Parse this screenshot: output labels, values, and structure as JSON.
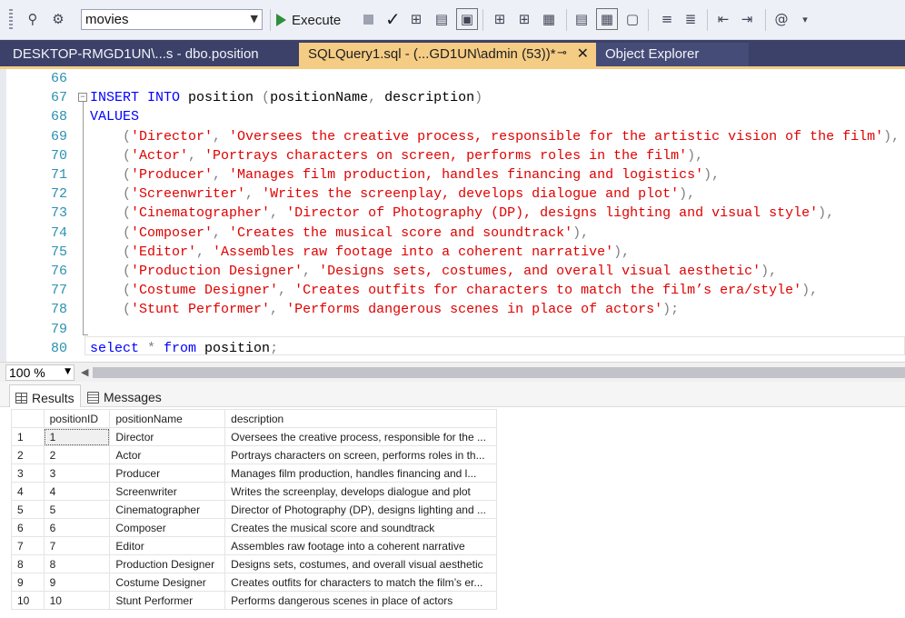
{
  "toolbar": {
    "database": "movies",
    "execute_label": "Execute",
    "icons": [
      "plugin-icon",
      "connect-icon",
      "database-dropdown",
      "execute-icon",
      "stop-icon",
      "parse-check-icon",
      "estimated-plan-icon",
      "query-options-icon",
      "intellisense-icon",
      "results-to-text-icon",
      "results-to-grid-icon",
      "results-to-file-icon",
      "comment-icon",
      "uncomment-icon",
      "decrease-indent-icon",
      "increase-indent-icon",
      "specify-values-icon"
    ]
  },
  "tabs": [
    {
      "label": "DESKTOP-RMGD1UN\\...s - dbo.position",
      "active": false
    },
    {
      "label": "SQLQuery1.sql - (...GD1UN\\admin (53))*",
      "active": true
    },
    {
      "label": "Object Explorer",
      "active": false
    }
  ],
  "editor": {
    "lines": [
      {
        "num": "66",
        "tokens": []
      },
      {
        "num": "67",
        "tokens": [
          [
            "kw",
            "INSERT INTO "
          ],
          [
            "plain",
            "position "
          ],
          [
            "gray",
            "("
          ],
          [
            "plain",
            "positionName"
          ],
          [
            "gray",
            ", "
          ],
          [
            "plain",
            "description"
          ],
          [
            "gray",
            ")"
          ]
        ]
      },
      {
        "num": "68",
        "tokens": [
          [
            "kw",
            "VALUES"
          ]
        ]
      },
      {
        "num": "69",
        "tokens": [
          [
            "gray",
            "    ("
          ],
          [
            "str",
            "'Director'"
          ],
          [
            "gray",
            ", "
          ],
          [
            "str",
            "'Oversees the creative process, responsible for the artistic vision of the film'"
          ],
          [
            "gray",
            "),"
          ]
        ]
      },
      {
        "num": "70",
        "tokens": [
          [
            "gray",
            "    ("
          ],
          [
            "str",
            "'Actor'"
          ],
          [
            "gray",
            ", "
          ],
          [
            "str",
            "'Portrays characters on screen, performs roles in the film'"
          ],
          [
            "gray",
            "),"
          ]
        ]
      },
      {
        "num": "71",
        "tokens": [
          [
            "gray",
            "    ("
          ],
          [
            "str",
            "'Producer'"
          ],
          [
            "gray",
            ", "
          ],
          [
            "str",
            "'Manages film production, handles financing and logistics'"
          ],
          [
            "gray",
            "),"
          ]
        ]
      },
      {
        "num": "72",
        "tokens": [
          [
            "gray",
            "    ("
          ],
          [
            "str",
            "'Screenwriter'"
          ],
          [
            "gray",
            ", "
          ],
          [
            "str",
            "'Writes the screenplay, develops dialogue and plot'"
          ],
          [
            "gray",
            "),"
          ]
        ]
      },
      {
        "num": "73",
        "tokens": [
          [
            "gray",
            "    ("
          ],
          [
            "str",
            "'Cinematographer'"
          ],
          [
            "gray",
            ", "
          ],
          [
            "str",
            "'Director of Photography (DP), designs lighting and visual style'"
          ],
          [
            "gray",
            "),"
          ]
        ]
      },
      {
        "num": "74",
        "tokens": [
          [
            "gray",
            "    ("
          ],
          [
            "str",
            "'Composer'"
          ],
          [
            "gray",
            ", "
          ],
          [
            "str",
            "'Creates the musical score and soundtrack'"
          ],
          [
            "gray",
            "),"
          ]
        ]
      },
      {
        "num": "75",
        "tokens": [
          [
            "gray",
            "    ("
          ],
          [
            "str",
            "'Editor'"
          ],
          [
            "gray",
            ", "
          ],
          [
            "str",
            "'Assembles raw footage into a coherent narrative'"
          ],
          [
            "gray",
            "),"
          ]
        ]
      },
      {
        "num": "76",
        "tokens": [
          [
            "gray",
            "    ("
          ],
          [
            "str",
            "'Production Designer'"
          ],
          [
            "gray",
            ", "
          ],
          [
            "str",
            "'Designs sets, costumes, and overall visual aesthetic'"
          ],
          [
            "gray",
            "),"
          ]
        ]
      },
      {
        "num": "77",
        "tokens": [
          [
            "gray",
            "    ("
          ],
          [
            "str",
            "'Costume Designer'"
          ],
          [
            "gray",
            ", "
          ],
          [
            "str",
            "'Creates outfits for characters to match the film’s era/style'"
          ],
          [
            "gray",
            "),"
          ]
        ]
      },
      {
        "num": "78",
        "tokens": [
          [
            "gray",
            "    ("
          ],
          [
            "str",
            "'Stunt Performer'"
          ],
          [
            "gray",
            ", "
          ],
          [
            "str",
            "'Performs dangerous scenes in place of actors'"
          ],
          [
            "gray",
            ");"
          ]
        ]
      },
      {
        "num": "79",
        "tokens": []
      },
      {
        "num": "80",
        "tokens": [
          [
            "kw",
            "select "
          ],
          [
            "gray",
            "* "
          ],
          [
            "kw",
            "from "
          ],
          [
            "plain",
            "position"
          ],
          [
            "gray",
            ";"
          ]
        ]
      }
    ]
  },
  "zoom": "100 %",
  "results_tabs": {
    "results": "Results",
    "messages": "Messages"
  },
  "grid": {
    "columns": [
      "positionID",
      "positionName",
      "description"
    ],
    "rows": [
      [
        "1",
        "1",
        "Director",
        "Oversees the creative process, responsible for the ..."
      ],
      [
        "2",
        "2",
        "Actor",
        "Portrays characters on screen, performs roles in th..."
      ],
      [
        "3",
        "3",
        "Producer",
        "Manages film production, handles financing and l..."
      ],
      [
        "4",
        "4",
        "Screenwriter",
        "Writes the screenplay, develops dialogue and plot"
      ],
      [
        "5",
        "5",
        "Cinematographer",
        "Director of Photography (DP), designs lighting and ..."
      ],
      [
        "6",
        "6",
        "Composer",
        "Creates the musical score and soundtrack"
      ],
      [
        "7",
        "7",
        "Editor",
        "Assembles raw footage into a coherent narrative"
      ],
      [
        "8",
        "8",
        "Production Designer",
        "Designs sets, costumes, and overall visual aesthetic"
      ],
      [
        "9",
        "9",
        "Costume Designer",
        "Creates outfits for characters to match the film’s er..."
      ],
      [
        "10",
        "10",
        "Stunt Performer",
        "Performs dangerous scenes in place of actors"
      ]
    ]
  }
}
